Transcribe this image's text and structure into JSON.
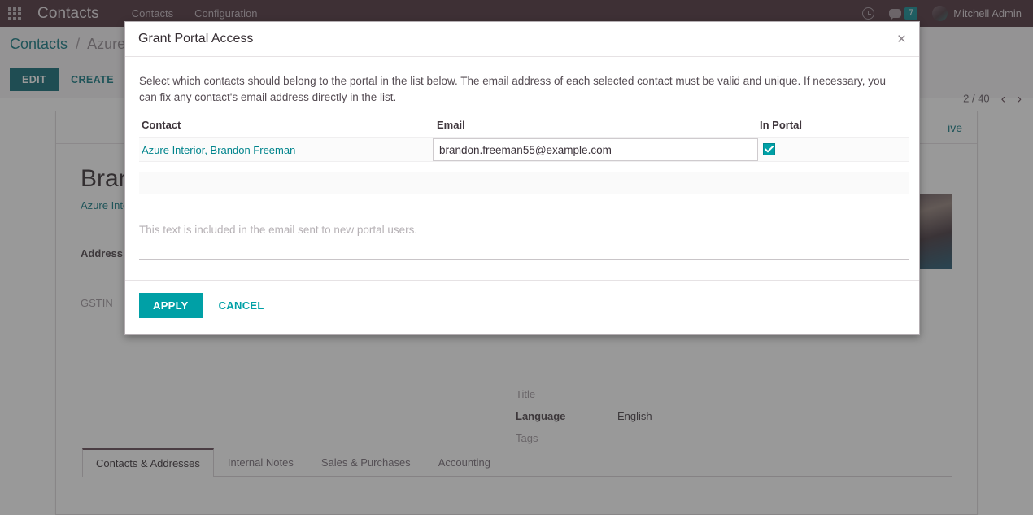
{
  "navbar": {
    "apps_icon": "apps-grid-icon",
    "brand": "Contacts",
    "menu": [
      {
        "label": "Contacts"
      },
      {
        "label": "Configuration"
      }
    ],
    "clock_icon": "clock-icon",
    "messages_icon": "chat-bubble-icon",
    "messages_count": "7",
    "user_name": "Mitchell Admin",
    "background_color": "#41242f"
  },
  "control_panel": {
    "breadcrumb": {
      "root": "Contacts",
      "separator": "/",
      "current": "Azure I"
    },
    "edit_label": "EDIT",
    "create_label": "CREATE",
    "pager": {
      "count": "2 / 40",
      "prev_icon": "chevron-left-icon",
      "next_icon": "chevron-right-icon",
      "prev": "‹",
      "next": "›"
    }
  },
  "record": {
    "active_label": "ive",
    "title": "Bran",
    "parent": "Azure Inte",
    "fields_left": [
      {
        "label": "Address",
        "value": ""
      },
      {
        "label": "GSTIN",
        "value": ""
      }
    ],
    "fields_right": [
      {
        "label": "Title",
        "value": ""
      },
      {
        "label": "Language",
        "value": "English"
      },
      {
        "label": "Tags",
        "value": ""
      }
    ],
    "photo": "contact-photo"
  },
  "notebook": {
    "tabs": [
      {
        "label": "Contacts & Addresses",
        "active": true
      },
      {
        "label": "Internal Notes",
        "active": false
      },
      {
        "label": "Sales & Purchases",
        "active": false
      },
      {
        "label": "Accounting",
        "active": false
      }
    ]
  },
  "dialog": {
    "title": "Grant Portal Access",
    "close_icon": "close-icon",
    "close_glyph": "×",
    "intro": "Select which contacts should belong to the portal in the list below. The email address of each selected contact must be valid and unique. If necessary, you can fix any contact's email address directly in the list.",
    "columns": {
      "contact": "Contact",
      "email": "Email",
      "in_portal": "In Portal"
    },
    "rows": [
      {
        "contact": "Azure Interior, Brandon Freeman",
        "email": "brandon.freeman55@example.com",
        "email_placeholder": "",
        "in_portal": true
      }
    ],
    "welcome_placeholder": "This text is included in the email sent to new portal users.",
    "welcome_value": "",
    "apply_label": "APPLY",
    "cancel_label": "CANCEL",
    "accent_color": "#00a0a6"
  }
}
